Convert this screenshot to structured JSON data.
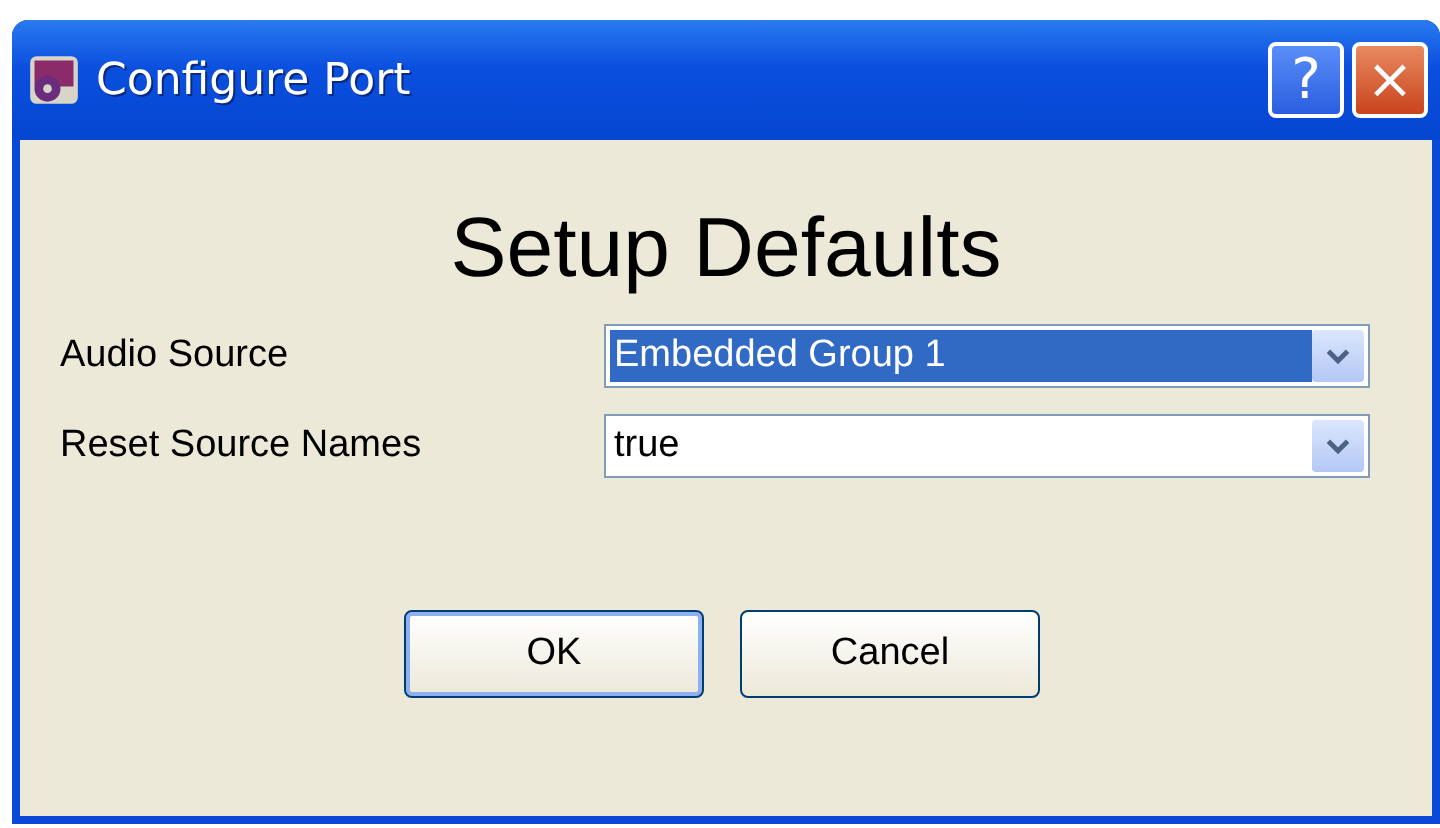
{
  "window": {
    "title": "Configure Port"
  },
  "title_buttons": [
    {
      "kind": "help",
      "label": "?"
    },
    {
      "kind": "close",
      "label": "×"
    }
  ],
  "heading": "Setup Defaults",
  "fields": [
    {
      "label": "Audio Source",
      "value": "Embedded Group 1",
      "focused": true
    },
    {
      "label": "Reset Source Names",
      "value": "true",
      "focused": false
    }
  ],
  "buttons": [
    {
      "label": "OK",
      "default": true
    },
    {
      "label": "Cancel",
      "default": false
    }
  ]
}
